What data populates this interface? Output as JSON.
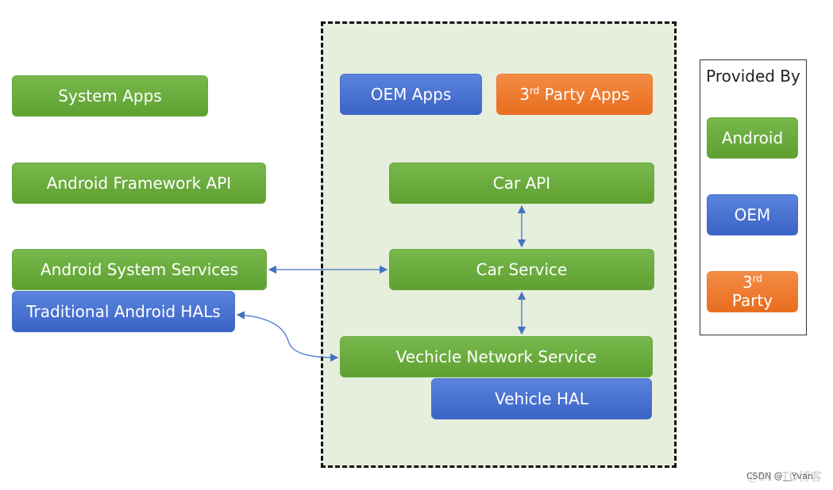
{
  "left": {
    "system_apps": "System Apps",
    "framework_api": "Android Framework API",
    "system_services": "Android System Services",
    "hals": "Traditional Android HALs"
  },
  "car": {
    "oem_apps": "OEM Apps",
    "third_party_apps_sup": "rd",
    "third_party_apps_pre": "3",
    "third_party_apps_post": " Party Apps",
    "car_api": "Car API",
    "car_service": "Car Service",
    "vns": "Vechicle Network Service",
    "vehicle_hal": "Vehicle HAL"
  },
  "legend": {
    "title": "Provided By",
    "android": "Android",
    "oem": "OEM",
    "third_pre": "3",
    "third_sup": "rd",
    "third_post": "Party"
  },
  "watermark": {
    "csdn": "CSDN @__Yvan",
    "cto": "@51CTO博客"
  },
  "colors": {
    "android": "#6aa840",
    "oem": "#4670cf",
    "third_party": "#ee7a2f",
    "arrow": "#4472c4"
  }
}
